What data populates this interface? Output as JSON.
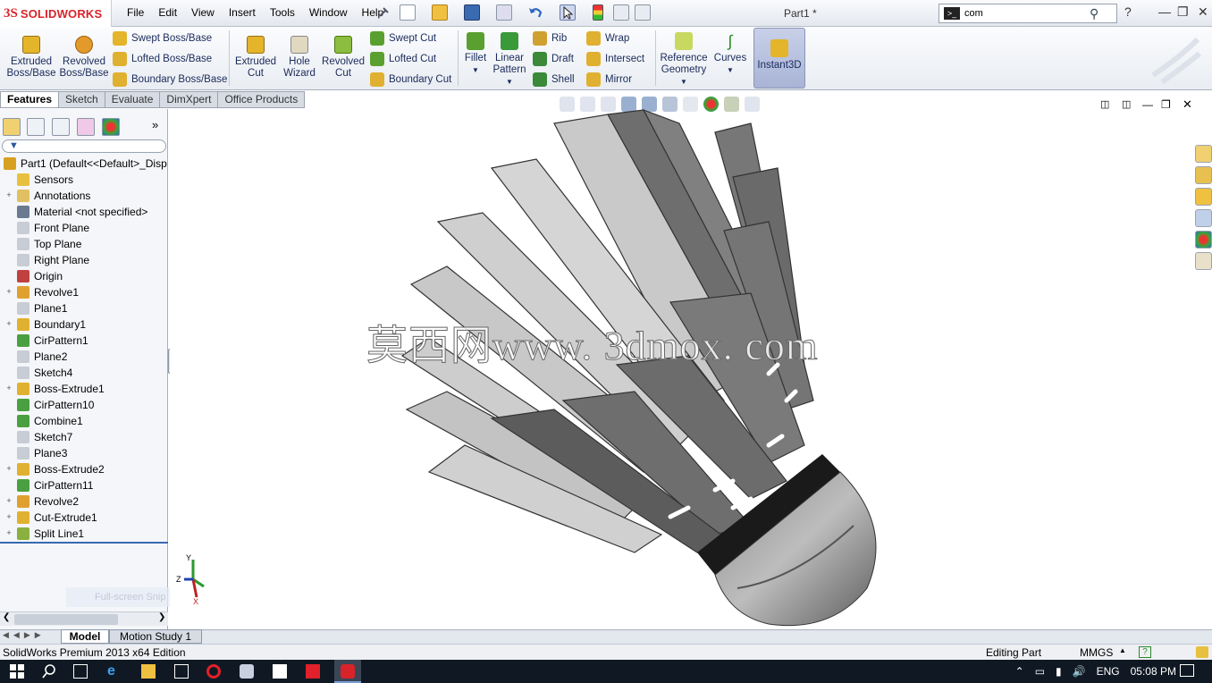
{
  "app": {
    "logo_ds": "3S",
    "logo_name": "SOLIDWORKS",
    "doc_title": "Part1 *"
  },
  "menu": [
    "File",
    "Edit",
    "View",
    "Insert",
    "Tools",
    "Window",
    "Help"
  ],
  "search": {
    "value": "com"
  },
  "ribbon": {
    "extruded_boss": "Extruded Boss/Base",
    "revolved_boss": "Revolved Boss/Base",
    "swept_boss": "Swept Boss/Base",
    "lofted_boss": "Lofted Boss/Base",
    "boundary_boss": "Boundary Boss/Base",
    "extruded_cut": "Extruded Cut",
    "hole_wizard": "Hole Wizard",
    "revolved_cut": "Revolved Cut",
    "swept_cut": "Swept Cut",
    "lofted_cut": "Lofted Cut",
    "boundary_cut": "Boundary Cut",
    "fillet": "Fillet",
    "linear_pattern": "Linear Pattern",
    "rib": "Rib",
    "draft": "Draft",
    "shell": "Shell",
    "wrap": "Wrap",
    "intersect": "Intersect",
    "mirror": "Mirror",
    "ref_geometry": "Reference Geometry",
    "curves": "Curves",
    "instant3d": "Instant3D"
  },
  "tabs": [
    "Features",
    "Sketch",
    "Evaluate",
    "DimXpert",
    "Office Products"
  ],
  "tree": [
    {
      "label": "Part1  (Default<<Default>_Disp",
      "icon": "part-icon",
      "color": "#d8a020",
      "exp": ""
    },
    {
      "label": "Sensors",
      "icon": "sensor-icon",
      "color": "#e8c040",
      "exp": ""
    },
    {
      "label": "Annotations",
      "icon": "annotation-icon",
      "color": "#e0c060",
      "exp": "+"
    },
    {
      "label": "Material <not specified>",
      "icon": "material-icon",
      "color": "#6a7a90",
      "exp": ""
    },
    {
      "label": "Front Plane",
      "icon": "plane-icon",
      "color": "#c8ccd4",
      "exp": ""
    },
    {
      "label": "Top Plane",
      "icon": "plane-icon",
      "color": "#c8ccd4",
      "exp": ""
    },
    {
      "label": "Right Plane",
      "icon": "plane-icon",
      "color": "#c8ccd4",
      "exp": ""
    },
    {
      "label": "Origin",
      "icon": "origin-icon",
      "color": "#c04040",
      "exp": ""
    },
    {
      "label": "Revolve1",
      "icon": "revolve-icon",
      "color": "#e0a030",
      "exp": "+"
    },
    {
      "label": "Plane1",
      "icon": "plane-icon",
      "color": "#c8ccd4",
      "exp": ""
    },
    {
      "label": "Boundary1",
      "icon": "boundary-icon",
      "color": "#e0b030",
      "exp": "+"
    },
    {
      "label": "CirPattern1",
      "icon": "pattern-icon",
      "color": "#4aa040",
      "exp": ""
    },
    {
      "label": "Plane2",
      "icon": "plane-icon",
      "color": "#c8ccd4",
      "exp": ""
    },
    {
      "label": "Sketch4",
      "icon": "sketch-icon",
      "color": "#c8ccd4",
      "exp": ""
    },
    {
      "label": "Boss-Extrude1",
      "icon": "extrude-icon",
      "color": "#e0b030",
      "exp": "+"
    },
    {
      "label": "CirPattern10",
      "icon": "pattern-icon",
      "color": "#4aa040",
      "exp": ""
    },
    {
      "label": "Combine1",
      "icon": "pattern-icon",
      "color": "#4aa040",
      "exp": ""
    },
    {
      "label": "Sketch7",
      "icon": "sketch-icon",
      "color": "#c8ccd4",
      "exp": ""
    },
    {
      "label": "Plane3",
      "icon": "plane-icon",
      "color": "#c8ccd4",
      "exp": ""
    },
    {
      "label": "Boss-Extrude2",
      "icon": "extrude-icon",
      "color": "#e0b030",
      "exp": "+"
    },
    {
      "label": "CirPattern11",
      "icon": "pattern-icon",
      "color": "#4aa040",
      "exp": ""
    },
    {
      "label": "Revolve2",
      "icon": "revolve-icon",
      "color": "#e0a030",
      "exp": "+"
    },
    {
      "label": "Cut-Extrude1",
      "icon": "cut-icon",
      "color": "#e0b030",
      "exp": "+"
    },
    {
      "label": "Split Line1",
      "icon": "splitline-icon",
      "color": "#8ab040",
      "exp": "+"
    }
  ],
  "overlay": {
    "watermark": "莫西网www. 3dmox. com",
    "snip": "Full-screen Snip"
  },
  "triad": {
    "x": "X",
    "y": "Y",
    "z": "Z"
  },
  "bottom_tabs": [
    "Model",
    "Motion Study 1"
  ],
  "status": {
    "edition": "SolidWorks Premium 2013 x64 Edition",
    "mode": "Editing Part",
    "units": "MMGS"
  },
  "taskbar": {
    "lang": "ENG",
    "time": "05:08 PM"
  }
}
